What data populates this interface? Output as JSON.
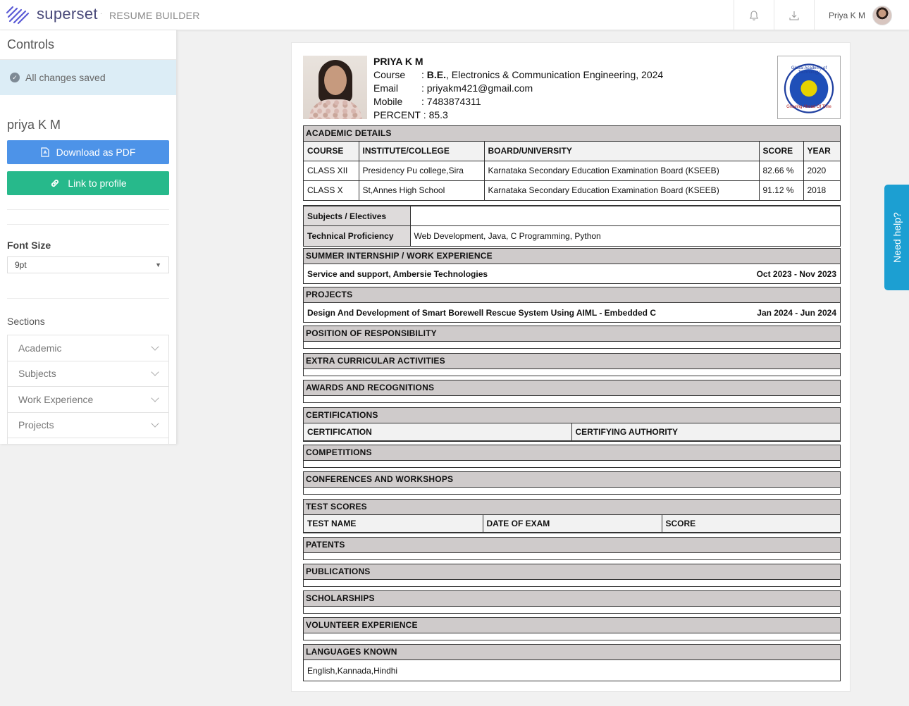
{
  "topbar": {
    "brand": "superset",
    "brand_separator": "·",
    "product": "RESUME BUILDER",
    "user_name": "Priya K M",
    "icons": [
      "bell-icon",
      "download-icon"
    ]
  },
  "sidebar": {
    "title": "Controls",
    "saved_status": "All changes saved",
    "profile_name": "priya K M",
    "download_label": "Download as PDF",
    "link_label": "Link to profile",
    "font_size_label": "Font Size",
    "font_size_value": "9pt",
    "sections_label": "Sections",
    "sections": [
      {
        "label": "Academic"
      },
      {
        "label": "Subjects"
      },
      {
        "label": "Work Experience"
      },
      {
        "label": "Projects"
      }
    ]
  },
  "help": {
    "label": "Need help?"
  },
  "resume": {
    "name": "PRIYA K M",
    "course_key": "Course",
    "course_degree": "B.E.",
    "course_rest": ", Electronics & Communication Engineering, 2024",
    "email_key": "Email",
    "email": "priyakm421@gmail.com",
    "mobile_key": "Mobile",
    "mobile": "7483874311",
    "percent_key": "PERCENT",
    "percent": "85.3",
    "colon": ":",
    "seal_top": "Global Academy of Technology",
    "seal_bottom": "Growing Ahead Of Time",
    "academic": {
      "title": "ACADEMIC DETAILS",
      "headers": [
        "COURSE",
        "INSTITUTE/COLLEGE",
        "BOARD/UNIVERSITY",
        "SCORE",
        "YEAR"
      ],
      "rows": [
        [
          "CLASS XII",
          "Presidency Pu college,Sira",
          "Karnataka Secondary Education Examination Board (KSEEB)",
          "82.66 %",
          "2020"
        ],
        [
          "CLASS X",
          "St,Annes High School",
          "Karnataka Secondary Education Examination Board (KSEEB)",
          "91.12 %",
          "2018"
        ]
      ]
    },
    "subjects": {
      "electives_label": "Subjects / Electives",
      "electives_value": "",
      "technical_label": "Technical Proficiency",
      "technical_value": "Web Development, Java, C Programming, Python"
    },
    "internship": {
      "title": "SUMMER INTERNSHIP / WORK EXPERIENCE",
      "entry": "Service and support, Ambersie Technologies",
      "dates": "Oct 2023 - Nov 2023"
    },
    "projects": {
      "title": "PROJECTS",
      "entry": "Design And Development of Smart Borewell Rescue System Using AIML - Embedded C",
      "dates": "Jan 2024 - Jun 2024"
    },
    "por": "POSITION OF RESPONSIBILITY",
    "extra": "EXTRA CURRICULAR ACTIVITIES",
    "awards": "AWARDS AND RECOGNITIONS",
    "certifications": {
      "title": "CERTIFICATIONS",
      "headers": [
        "CERTIFICATION",
        "CERTIFYING AUTHORITY"
      ]
    },
    "competitions": "COMPETITIONS",
    "conferences": "CONFERENCES AND WORKSHOPS",
    "test_scores": {
      "title": "TEST SCORES",
      "headers": [
        "TEST NAME",
        "DATE OF EXAM",
        "SCORE"
      ]
    },
    "patents": "PATENTS",
    "publications": "PUBLICATIONS",
    "scholarships": "SCHOLARSHIPS",
    "volunteer": "VOLUNTEER EXPERIENCE",
    "languages": {
      "title": "LANGUAGES KNOWN",
      "value": "English,Kannada,Hindhi"
    }
  }
}
